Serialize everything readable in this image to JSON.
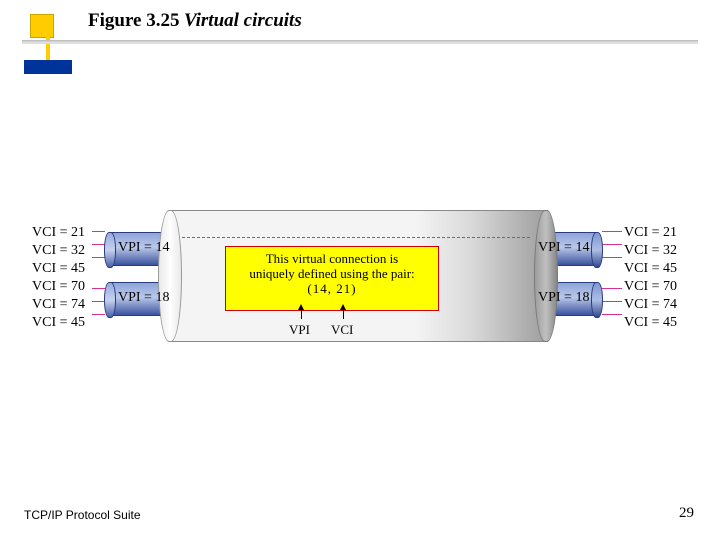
{
  "header": {
    "figure_no": "Figure 3.25",
    "figure_title": "Virtual circuits"
  },
  "footer": {
    "left": "TCP/IP Protocol Suite",
    "page": "29"
  },
  "colors": {
    "accent_yellow": "#ffcc00",
    "accent_blue": "#003399",
    "wire_magenta": "#d83090",
    "callout_bg": "#ffff00",
    "callout_border": "#d00000"
  },
  "vci": {
    "left": [
      "VCI = 21",
      "VCI = 32",
      "VCI = 45",
      "VCI = 70",
      "VCI = 74",
      "VCI = 45"
    ],
    "right": [
      "VCI = 21",
      "VCI = 32",
      "VCI = 45",
      "VCI = 70",
      "VCI = 74",
      "VCI = 45"
    ]
  },
  "vpi": {
    "left_top": "VPI = 14",
    "left_bot": "VPI = 18",
    "right_top": "VPI = 14",
    "right_bot": "VPI = 18"
  },
  "callout": {
    "line1": "This virtual connection is",
    "line2": "uniquely defined using the pair:",
    "pair": "(14, 21)",
    "labelA": "VPI",
    "labelB": "VCI"
  }
}
